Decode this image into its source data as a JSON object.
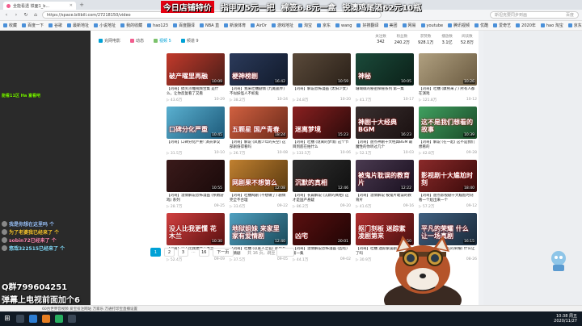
{
  "overlay": {
    "banner": [
      "今日店铺特价",
      "指甲刀5元一把",
      "棉签6.8元一盒",
      "锐澳鸡尾酒62元10瓶"
    ],
    "left_chat_green": "能看11区 Ha 富看吧",
    "chat": [
      "我是你想在这里吗 个",
      "为了老婆我已经来了 个",
      "sobin72已经来了 个",
      "悠哉322515已经来了 个"
    ],
    "qq": "Q群799604251",
    "danmu": "弹幕上电视前面加个6"
  },
  "browser": {
    "tab_title": "全能看透 铁面1_b...",
    "url": "https://space.bilibili.com/27218150/video",
    "search_placeholder": "斯坦克要同步到画",
    "search_extra": "百度",
    "bookmarks": [
      "收藏",
      "百度一下",
      "谷歌",
      "最新地址",
      "小说地址",
      "我的收藏",
      "hao123",
      "百度翻译",
      "NBA 直",
      "新浪体育",
      "AirDr",
      "游戏地址",
      "淘宝",
      "京东",
      "wang",
      "好搜翻译",
      "美团",
      "网易",
      "youtube",
      "腾讯视频",
      "优酷",
      "爱奇艺",
      "2020年",
      "hao 淘宝",
      "京东购"
    ]
  },
  "subnav": [
    {
      "label": "充网电影",
      "active": false
    },
    {
      "label": "动态",
      "active": false
    },
    {
      "label": "视频 5",
      "active": true
    },
    {
      "label": "频道 9",
      "active": false
    }
  ],
  "stats": [
    {
      "label": "关注数",
      "value": "342"
    },
    {
      "label": "粉丝数",
      "value": "240.2万"
    },
    {
      "label": "获赞数",
      "value": "928.1万"
    },
    {
      "label": "播放数",
      "value": "3.1亿"
    },
    {
      "label": "阅读数",
      "value": "52.8万"
    }
  ],
  "videos": [
    {
      "thumb": "破产曜里再融",
      "duration": "10:09",
      "title": "【刘哥】搞笑沙雕视频合集 是什么，让你反复看了又看",
      "views": "43.6万",
      "date": "10-29",
      "c1": "#c23a2b",
      "c2": "#4a1d18"
    },
    {
      "thumb": "梗神榜剧",
      "duration": "16:42",
      "title": "【刘哥】我来吐槽剧情 [九尾狐传] 不似妖怪人不如鬼",
      "views": "38.2万",
      "date": "10-24",
      "c1": "#2b3a5a",
      "c2": "#111a2b"
    },
    {
      "thumb": "",
      "duration": "10:59",
      "title": "【刘哥】解说恐怖漫画 (太阳少女)",
      "views": "24.8万",
      "date": "10-20",
      "c1": "#5a4a3a",
      "c2": "#2a2018"
    },
    {
      "thumb": "神秘",
      "duration": "10:05",
      "title": "珊瑚礁的秘密探秘系列 第一集",
      "views": "41.7万",
      "date": "10-17",
      "c1": "#1b4a3a",
      "c2": "#0b2018"
    },
    {
      "thumb": "",
      "duration": "10:26",
      "title": "【刘哥】吐槽 (康熙来了) 所有人都在演戏",
      "views": "121.8万",
      "date": "10-12",
      "c1": "#b0a080",
      "c2": "#6a5a40"
    },
    {
      "thumb": "口碑分化严重",
      "duration": "10:45",
      "title": "【刘哥】口碑分化严重! 演员争议",
      "views": "31.5万",
      "date": "10-10",
      "c1": "#5ab0d0",
      "c2": "#1d5a7a"
    },
    {
      "thumb": "五颗星 国产青春",
      "duration": "18:24",
      "title": "【刘哥】解说 (凤凰少年的天空) 这部剧值得看吗",
      "views": "26.7万",
      "date": "10-08",
      "c1": "#d06040",
      "c2": "#6a2a1a"
    },
    {
      "thumb": "迷离梦境",
      "duration": "15:23",
      "title": "【刘哥】吐槽 (谜离的梦境) 这个节目到底在拍什么",
      "views": "133.5万",
      "date": "10-06",
      "c1": "#8a2020",
      "c2": "#2a0a0a"
    },
    {
      "thumb": "神剧十大经典BGM",
      "duration": "16:23",
      "title": "【刘哥】盘点神剧十大经典BGM 最魔性的你听过几个",
      "views": "52.1万",
      "date": "10-03",
      "c1": "#3a3030",
      "c2": "#1a1010"
    },
    {
      "thumb": "这不是我们想看的故事",
      "duration": "10:39",
      "title": "【刘哥】解说 (在一起) 这不是我们想看的",
      "views": "42.8万",
      "date": "09-28",
      "c1": "#40a060",
      "c2": "#1a4a28"
    },
    {
      "thumb": "",
      "duration": "10:55",
      "title": "【刘哥】温情解说恐怖漫画 (杀戮游戏) 系列",
      "views": "28.7万",
      "date": "09-25",
      "c1": "#3a1a1a",
      "c2": "#1a0a0a"
    },
    {
      "thumb": "网剧果不想第么",
      "duration": "12:08",
      "title": "【刘哥】吐槽网剧 (不想做了) 剧情完全不合理",
      "views": "33.6万",
      "date": "09-22",
      "c1": "#c08030",
      "c2": "#5a3a10"
    },
    {
      "thumb": "沉默的真相",
      "duration": "12:46",
      "title": "【刘哥】长篇解说 (沉默的真相) 这才是国产悬疑",
      "views": "86.2万",
      "date": "09-20",
      "c1": "#303030",
      "c2": "#101010"
    },
    {
      "thumb": "被鬼片耽误的教育片",
      "duration": "12:22",
      "title": "【刘哥】温情解说 被鬼片耽误的教育片",
      "views": "41.6万",
      "date": "09-16",
      "c1": "#4a3a50",
      "c2": "#1a1020"
    },
    {
      "thumb": "影视剧十大尴尬时刻",
      "duration": "18:40",
      "title": "【刘哥】盘点影视剧十大尴尬时刻 看一个尬出来一个",
      "views": "57.2万",
      "date": "09-12",
      "c1": "#8a2a2a",
      "c2": "#3a0a0a"
    },
    {
      "thumb": "没人比我更懂 花木兰",
      "duration": "10:30",
      "title": "【刘哥】没人比我更懂花木兰",
      "views": "52.4万",
      "date": "09-09",
      "c1": "#d04040",
      "c2": "#5a1010"
    },
    {
      "thumb": "地狱姐妹 来家里家有爱情剧",
      "duration": "12:40",
      "title": "【刘哥】吐槽 (以家人之名) 家里有爱情剧",
      "views": "37.5万",
      "date": "09-05",
      "c1": "#50a0c0",
      "c2": "#1a4a5a"
    },
    {
      "thumb": "凶宅",
      "duration": "20:01",
      "title": "【刘哥】温情解说恐怖漫画 (凶宅) 第一集",
      "views": "44.1万",
      "date": "09-02",
      "c1": "#5a1010",
      "c2": "#200505"
    },
    {
      "thumb": "抠门刻板 迷踪紫凌剧第来",
      "duration": "14:50",
      "title": "【刘哥】吐槽 迷踪紫凌剧 这不是来了吗",
      "views": "30.9万",
      "date": "08-29",
      "c1": "#b03030",
      "c2": "#4a1010"
    },
    {
      "thumb": "平凡的荣耀 什么让一场真剧",
      "duration": "16:15",
      "title": "【刘哥】吐槽 (平凡的荣耀) 什么让一场真剧",
      "views": "48.3万",
      "date": "08-26",
      "c1": "#406080",
      "c2": "#1a2a3a"
    }
  ],
  "pagination": {
    "pages": [
      "1",
      "2",
      "3"
    ],
    "ellipsis": "···",
    "last": "16",
    "next": "下一页",
    "total": "共 16 页，跳至"
  },
  "statusbar": "60台世界音视频 爱宝投注网站 万家乐 万通打印宝直播设置",
  "clock": {
    "time": "10:38 周五",
    "date": "2020/11/27"
  }
}
